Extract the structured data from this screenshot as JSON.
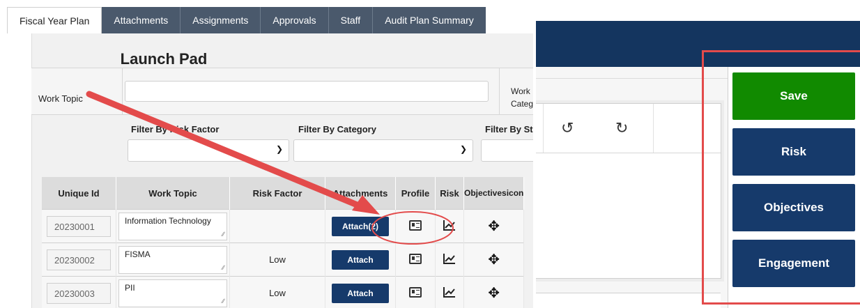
{
  "tabs": [
    "Fiscal Year Plan",
    "Attachments",
    "Assignments",
    "Approvals",
    "Staff",
    "Audit Plan Summary"
  ],
  "launch_pad_title": "Launch Pad",
  "work_topic_label": "Work Topic",
  "work_category_label": "Work Category",
  "filters": {
    "risk_factor_label": "Filter By Risk Factor",
    "category_label": "Filter By Category",
    "status_label": "Filter By Status"
  },
  "table": {
    "headers": [
      "Unique Id",
      "Work Topic",
      "Risk Factor",
      "Attachments",
      "Profile",
      "Risk",
      "Objectivesicon"
    ],
    "rows": [
      {
        "id": "20230001",
        "topic": "Information Technology",
        "risk_factor": "",
        "attach": "Attach(2)"
      },
      {
        "id": "20230002",
        "topic": "FISMA",
        "risk_factor": "Low",
        "attach": "Attach"
      },
      {
        "id": "20230003",
        "topic": "PII",
        "risk_factor": "Low",
        "attach": "Attach"
      }
    ]
  },
  "right_buttons": {
    "save": "Save",
    "risk": "Risk",
    "objectives": "Objectives",
    "engagement": "Engagement"
  },
  "colors": {
    "navy": "#163a6b",
    "green": "#118a00",
    "annotation_red": "#e34b4b",
    "tab_bg": "#4a596c"
  },
  "icons": [
    "profile-icon",
    "risk-chart-icon",
    "move-icon",
    "undo-icon",
    "redo-icon",
    "chevron-down-icon"
  ]
}
